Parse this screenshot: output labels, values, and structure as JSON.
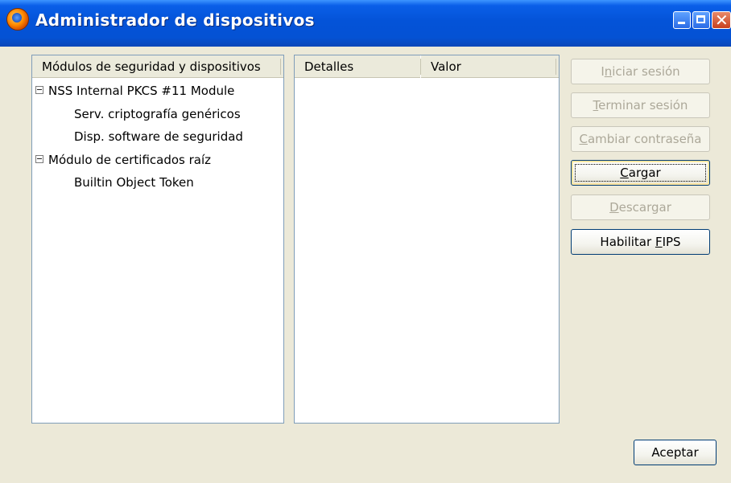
{
  "window": {
    "title": "Administrador de dispositivos",
    "icon": "firefox-icon"
  },
  "modules_panel": {
    "header": "Módulos de seguridad y dispositivos",
    "tree": [
      {
        "label": "NSS Internal PKCS #11 Module",
        "expanded": true,
        "children": [
          "Serv. criptografía genéricos",
          "Disp. software de seguridad"
        ]
      },
      {
        "label": "Módulo de certificados raíz",
        "expanded": true,
        "children": [
          "Builtin Object Token"
        ]
      }
    ]
  },
  "details_panel": {
    "col_details": "Detalles",
    "col_value": "Valor"
  },
  "buttons": {
    "login": {
      "pre": "I",
      "key": "n",
      "post": "iciar sesión",
      "enabled": false
    },
    "logout": {
      "pre": "",
      "key": "T",
      "post": "erminar sesión",
      "enabled": false
    },
    "change_password": {
      "pre": "",
      "key": "C",
      "post": "ambiar contraseña",
      "enabled": false
    },
    "load": {
      "pre": "",
      "key": "C",
      "post": "argar",
      "enabled": true
    },
    "unload": {
      "pre": "",
      "key": "D",
      "post": "escargar",
      "enabled": false
    },
    "enable_fips": {
      "pre": "Habilitar ",
      "key": "F",
      "post": "IPS",
      "enabled": true
    },
    "ok": "Aceptar"
  }
}
